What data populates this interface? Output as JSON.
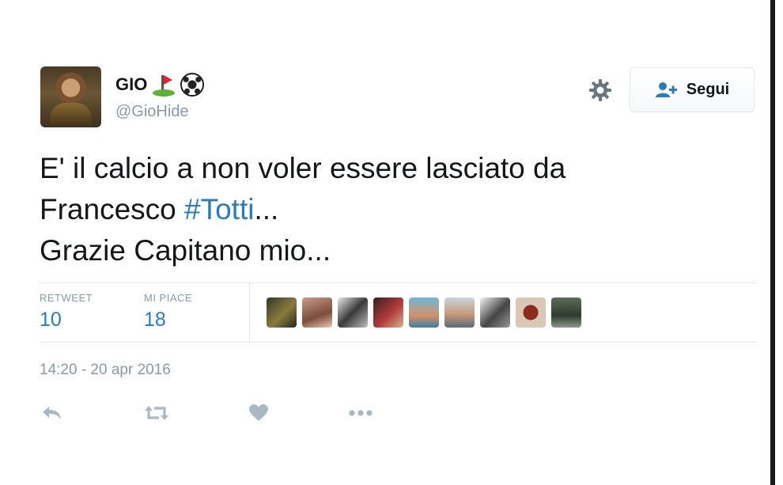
{
  "user": {
    "display_name": "GIO",
    "name_emojis": [
      "golf-flag-emoji",
      "soccer-ball-emoji"
    ],
    "handle": "@GioHide"
  },
  "follow_button": {
    "label": "Segui",
    "icon": "follow-person-icon"
  },
  "settings_icon": "gear-icon",
  "tweet": {
    "line1": "E' il calcio a non voler essere lasciato da",
    "line2_prefix": "Francesco ",
    "hashtag": "#Totti",
    "line2_suffix": "...",
    "line3": "Grazie Capitano mio..."
  },
  "stats": {
    "retweet_label": "RETWEET",
    "retweet_count": "10",
    "likes_label": "MI PIACE",
    "likes_count": "18"
  },
  "liker_avatars": 9,
  "timestamp": "14:20 - 20 apr 2016",
  "actions": [
    "reply-icon",
    "retweet-icon",
    "like-icon",
    "more-icon"
  ],
  "colors": {
    "link": "#2b7bb9",
    "muted": "#8899a6",
    "text": "#14171a",
    "divider": "#e1e8ed"
  }
}
